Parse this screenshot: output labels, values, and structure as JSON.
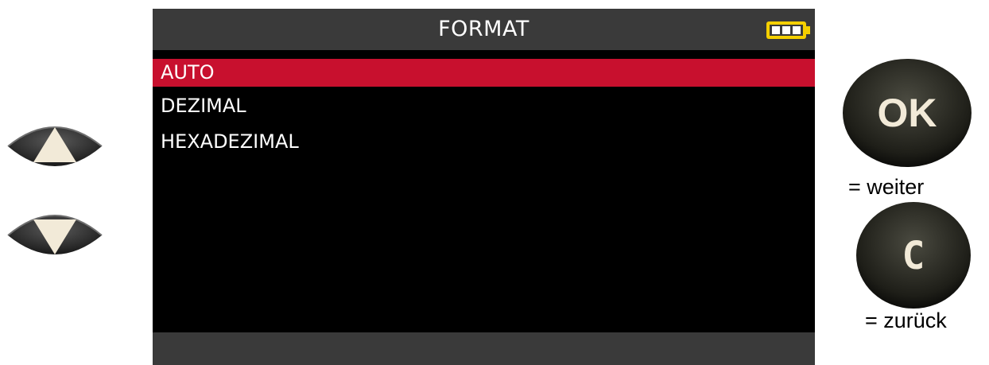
{
  "screen": {
    "title": "FORMAT",
    "battery_icon": "battery-full-icon",
    "menu": [
      {
        "label": "AUTO",
        "selected": true
      },
      {
        "label": "DEZIMAL",
        "selected": false
      },
      {
        "label": "HEXADEZIMAL",
        "selected": false
      }
    ]
  },
  "buttons": {
    "ok": {
      "glyph": "OK",
      "caption": "= weiter"
    },
    "c": {
      "glyph": "C",
      "caption": "= zurück"
    },
    "up_icon": "arrow-up-icon",
    "down_icon": "arrow-down-icon"
  },
  "colors": {
    "selection": "#c8102e",
    "bar": "#3a3a3a",
    "screen": "#000000",
    "battery": "#f5d000"
  }
}
